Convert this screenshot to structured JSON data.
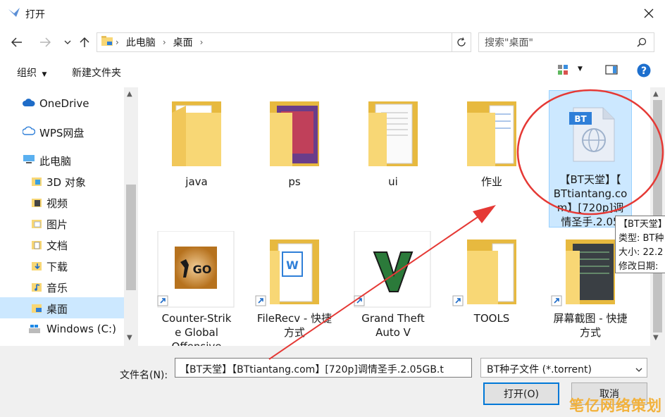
{
  "window": {
    "title": "打开"
  },
  "address": {
    "crumbs": [
      "此电脑",
      "桌面"
    ],
    "search_placeholder": "搜索\"桌面\""
  },
  "toolbar": {
    "organize": "组织",
    "new_folder": "新建文件夹"
  },
  "sidebar": {
    "items": [
      {
        "label": "OneDrive",
        "icon": "cloud-icon"
      },
      {
        "label": "WPS网盘",
        "icon": "cloud-outline-icon"
      },
      {
        "label": "此电脑",
        "icon": "computer-icon"
      },
      {
        "label": "3D 对象",
        "icon": "3d-objects-icon"
      },
      {
        "label": "视频",
        "icon": "video-folder-icon"
      },
      {
        "label": "图片",
        "icon": "pictures-folder-icon"
      },
      {
        "label": "文档",
        "icon": "documents-folder-icon"
      },
      {
        "label": "下载",
        "icon": "downloads-folder-icon"
      },
      {
        "label": "音乐",
        "icon": "music-folder-icon"
      },
      {
        "label": "桌面",
        "icon": "desktop-folder-icon"
      },
      {
        "label": "Windows (C:)",
        "icon": "drive-icon"
      }
    ]
  },
  "files": [
    {
      "caption": "java",
      "kind": "folder-docs"
    },
    {
      "caption": "ps",
      "kind": "folder-photos"
    },
    {
      "caption": "ui",
      "kind": "folder-paper"
    },
    {
      "caption": "作业",
      "kind": "folder-docs"
    },
    {
      "caption_lines": [
        "【BT天堂】【",
        "BTtiantang.co",
        "m】[720p]调",
        "情圣手.2.05"
      ],
      "kind": "bt-file",
      "badge": "BT"
    },
    {
      "caption_lines": [
        "Counter-Strik",
        "e Global",
        "Offensive"
      ],
      "kind": "shortcut-csgo",
      "badge": "GO"
    },
    {
      "caption_lines": [
        "FileRecv - 快捷",
        "方式"
      ],
      "kind": "shortcut-folder-wps"
    },
    {
      "caption_lines": [
        "Grand Theft",
        "Auto V"
      ],
      "kind": "shortcut-gta"
    },
    {
      "caption_lines": [
        "TOOLS"
      ],
      "kind": "shortcut-folder"
    },
    {
      "caption_lines": [
        "屏幕截图 - 快捷",
        "方式"
      ],
      "kind": "shortcut-folder-screens"
    }
  ],
  "tooltip": {
    "lines": [
      "【BT天堂】",
      "类型: BT种",
      "大小: 22.2",
      "修改日期:"
    ]
  },
  "bottom": {
    "filename_label": "文件名(N):",
    "filename_value": "【BT天堂】【BTtiantang.com】[720p]调情圣手.2.05GB.t",
    "filter_value": "BT种子文件 (*.torrent)",
    "open_label": "打开(O)",
    "cancel_label": "取消"
  },
  "watermark": "笔亿网络策划",
  "colors": {
    "accent": "#0078d7",
    "selected": "#cce8ff",
    "annotation_red": "#e53935",
    "folder": "#f8d775"
  }
}
